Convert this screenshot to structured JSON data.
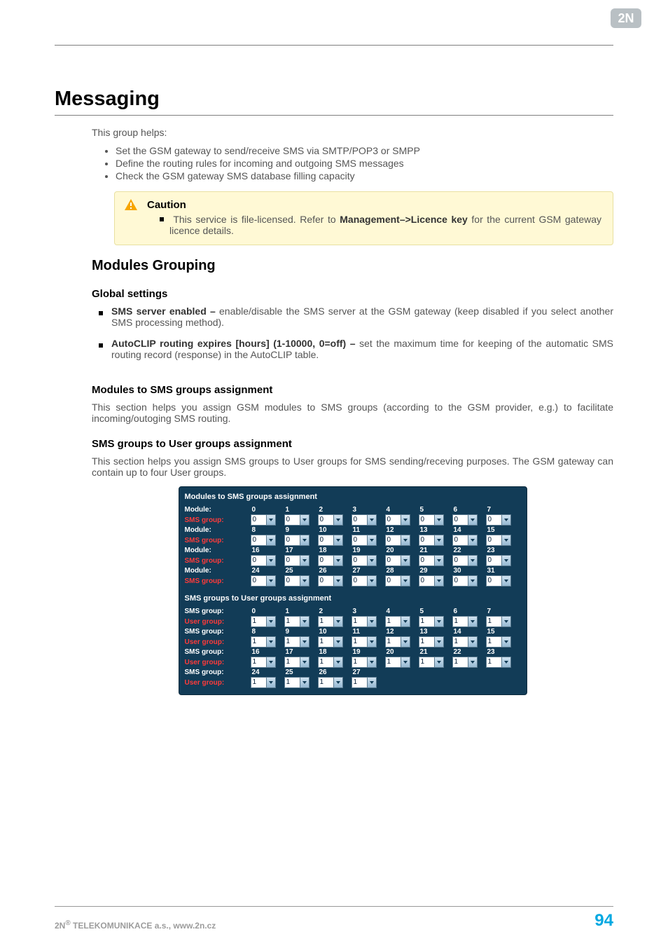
{
  "header": {
    "logo_text": "2N"
  },
  "title": "Messaging",
  "intro": "This group helps:",
  "intro_bullets": [
    "Set the GSM gateway to send/receive SMS via SMTP/POP3 or SMPP",
    "Define the routing rules for incoming and outgoing SMS messages",
    "Check the GSM gateway SMS database filling capacity"
  ],
  "caution": {
    "title": "Caution",
    "body_pre": "This service is file-licensed. Refer to ",
    "body_strong": "Management–>Licence key",
    "body_post": " for the current GSM gateway licence details."
  },
  "section_modules_grouping": "Modules Grouping",
  "sub_global": "Global settings",
  "settings": [
    {
      "strong": "SMS server enabled – ",
      "text": "enable/disable the SMS server at the GSM gateway (keep disabled if you select another SMS processing method)."
    },
    {
      "strong": "AutoCLIP routing expires [hours] (1-10000, 0=off) – ",
      "text": "set the maximum time for keeping of the automatic SMS routing record (response) in the AutoCLIP table."
    }
  ],
  "sub_mods_to_sms": "Modules to SMS groups assignment",
  "mods_to_sms_body": "This section helps you assign GSM modules to SMS groups (according to the GSM provider, e.g.) to facilitate incoming/outoging SMS routing.",
  "sub_sms_to_user": "SMS groups to User groups assignment",
  "sms_to_user_body": "This section helps you assign SMS groups to User groups for SMS sending/receving purposes. The GSM gateway can contain up to four User groups.",
  "panel": {
    "block1_title": "Modules to SMS groups assignment",
    "block2_title": "SMS groups to User groups assignment",
    "label_module": "Module:",
    "label_sms_group": "SMS group:",
    "label_user_group": "User group:",
    "block1": {
      "header_rows": [
        [
          "0",
          "1",
          "2",
          "3",
          "4",
          "5",
          "6",
          "7"
        ],
        [
          "8",
          "9",
          "10",
          "11",
          "12",
          "13",
          "14",
          "15"
        ],
        [
          "16",
          "17",
          "18",
          "19",
          "20",
          "21",
          "22",
          "23"
        ],
        [
          "24",
          "25",
          "26",
          "27",
          "28",
          "29",
          "30",
          "31"
        ]
      ],
      "select_value": "0"
    },
    "block2": {
      "header_rows": [
        [
          "0",
          "1",
          "2",
          "3",
          "4",
          "5",
          "6",
          "7"
        ],
        [
          "8",
          "9",
          "10",
          "11",
          "12",
          "13",
          "14",
          "15"
        ],
        [
          "16",
          "17",
          "18",
          "19",
          "20",
          "21",
          "22",
          "23"
        ],
        [
          "24",
          "25",
          "26",
          "27"
        ]
      ],
      "select_value": "1"
    }
  },
  "footer": {
    "left_pre": "2N",
    "left_sup": "®",
    "left_post": " TELEKOMUNIKACE a.s., www.2n.cz",
    "right": "94"
  }
}
